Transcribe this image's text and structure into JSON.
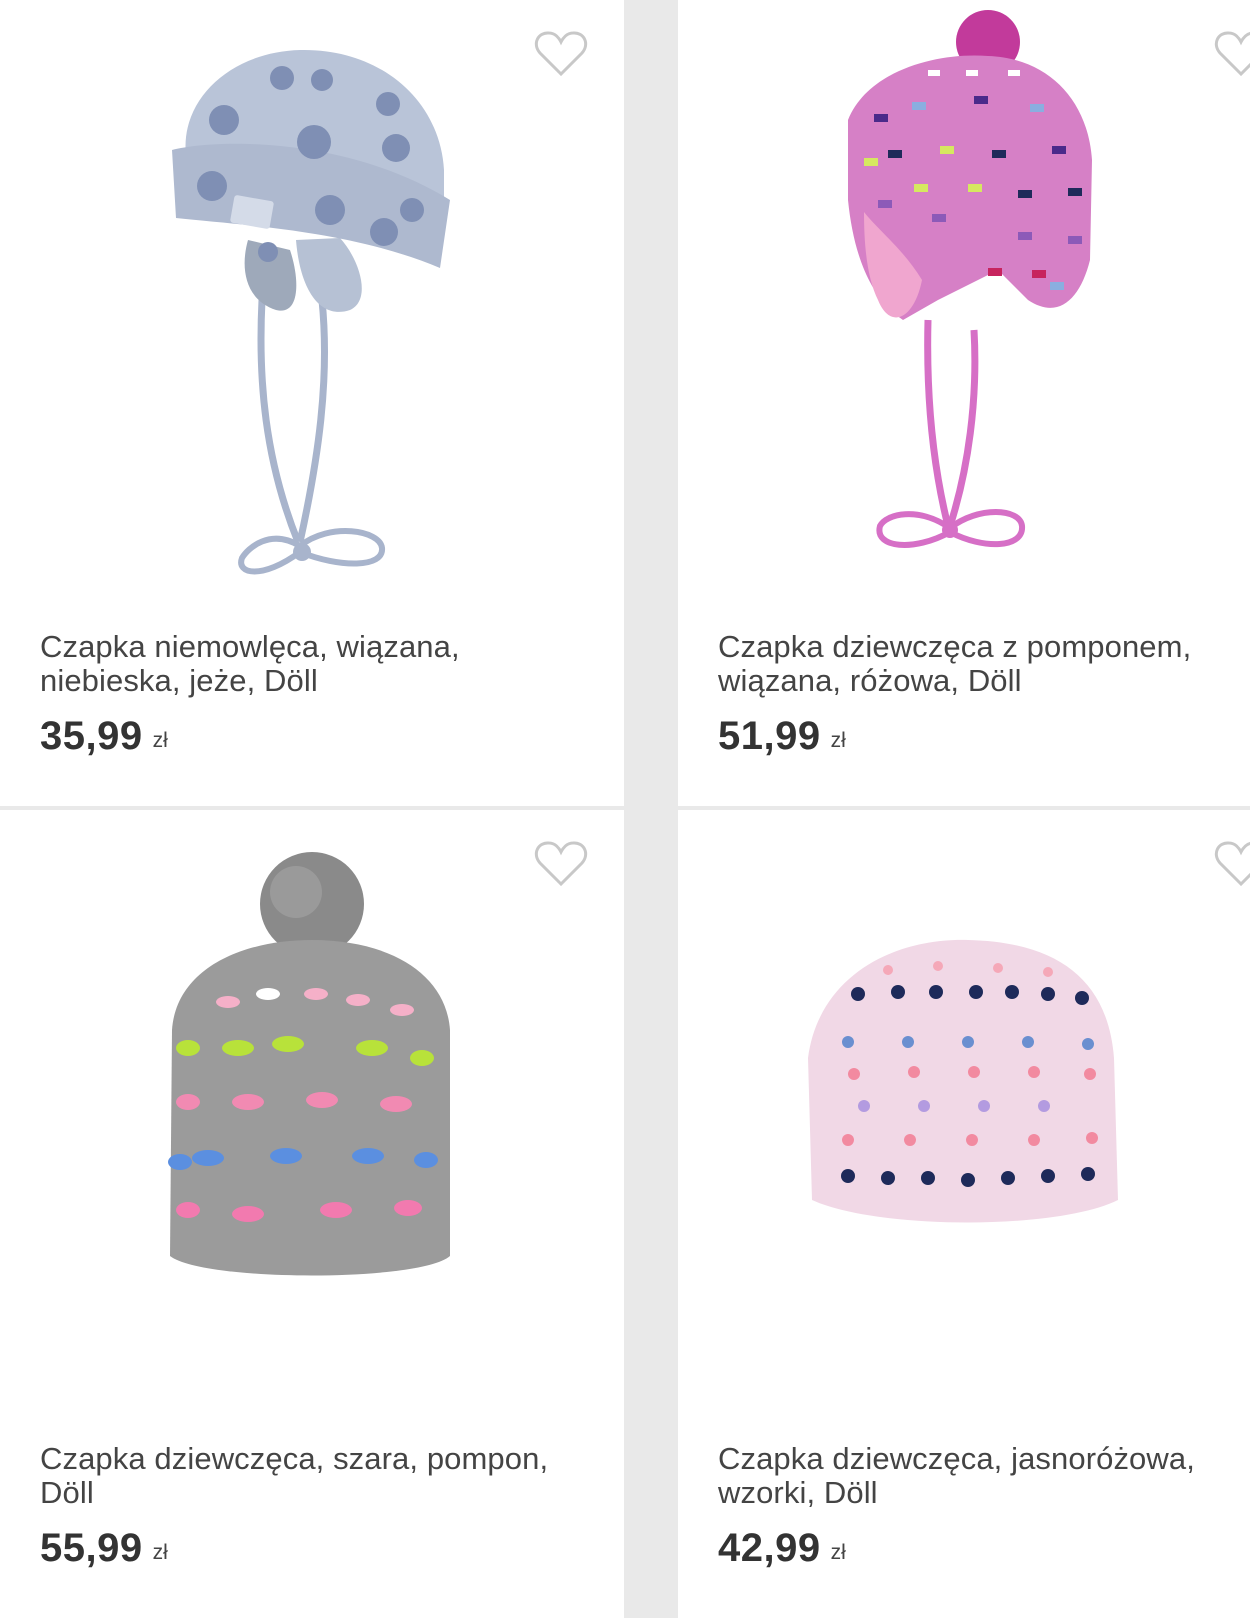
{
  "products": [
    {
      "image": "baby hat, light blue with hedgehog print and ties",
      "title": "Czapka niemowlęca, wiązana, niebieska, jeże, Döll",
      "price": "35,99",
      "currency": "zł",
      "favorite_icon": "heart-outline-icon"
    },
    {
      "image": "pink knitted girl hat with pompom and ties",
      "title": "Czapka dziewczęca z pomponem, wiązana, różowa, Döll",
      "price": "51,99",
      "currency": "zł",
      "favorite_icon": "heart-outline-icon"
    },
    {
      "image": "grey knitted girl hat with pompom",
      "title": "Czapka dziewczęca, szara, pompon, Döll",
      "price": "55,99",
      "currency": "zł",
      "favorite_icon": "heart-outline-icon"
    },
    {
      "image": "light pink knitted girl hat with patterns",
      "title": "Czapka dziewczęca, jasnoróżowa, wzorki, Döll",
      "price": "42,99",
      "currency": "zł",
      "favorite_icon": "heart-outline-icon"
    }
  ],
  "colors": {
    "background": "#e9e9e9",
    "card": "#ffffff",
    "text": "#444444",
    "price": "#333333",
    "heart_outline": "#c8c8c8"
  }
}
